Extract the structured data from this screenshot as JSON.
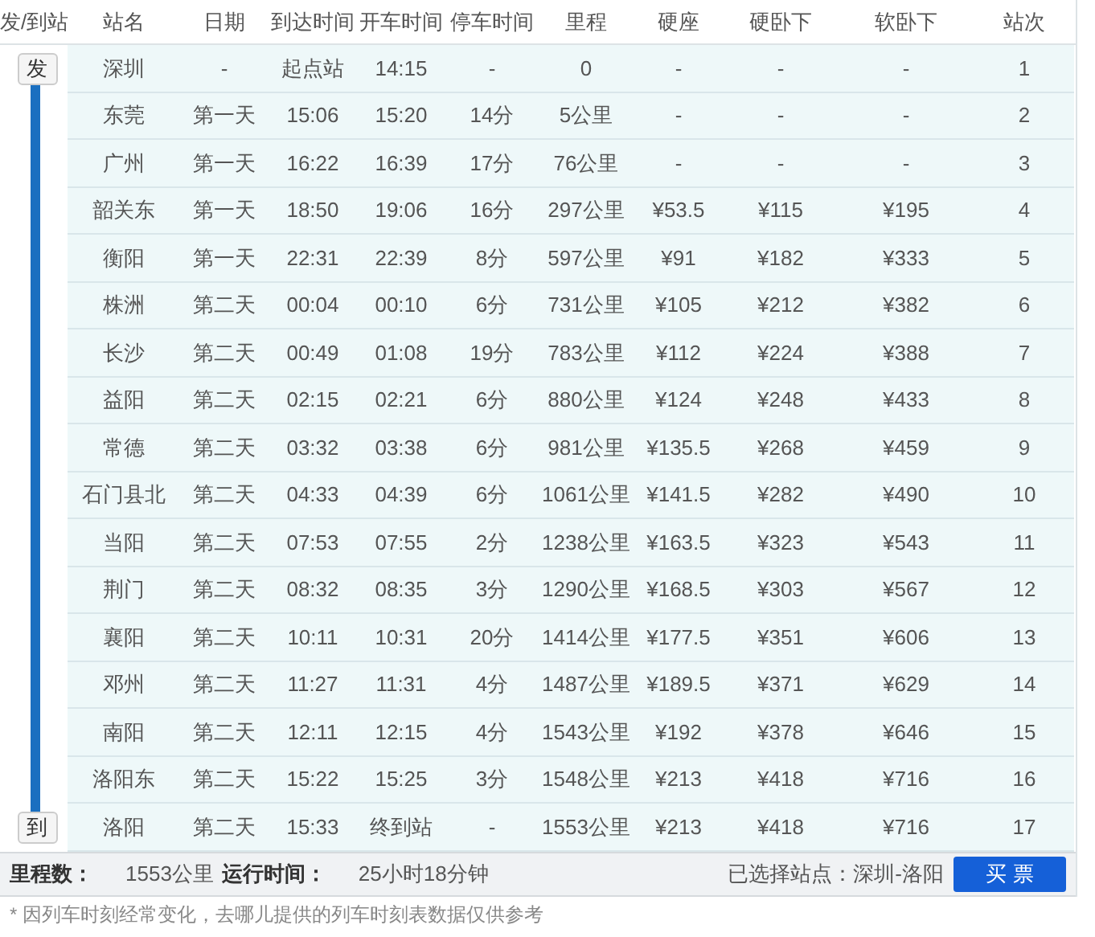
{
  "columns": [
    "发/到站",
    "站名",
    "日期",
    "到达时间",
    "开车时间",
    "停车时间",
    "里程",
    "硬座",
    "硬卧下",
    "软卧下",
    "站次"
  ],
  "rows": [
    {
      "marker": "发",
      "station": "深圳",
      "date": "-",
      "arrive": "起点站",
      "depart": "14:15",
      "stop": "-",
      "distance": "0",
      "hard_seat": "-",
      "hard_sleeper": "-",
      "soft_sleeper": "-",
      "index": "1"
    },
    {
      "station": "东莞",
      "date": "第一天",
      "arrive": "15:06",
      "depart": "15:20",
      "stop": "14分",
      "distance": "5公里",
      "hard_seat": "-",
      "hard_sleeper": "-",
      "soft_sleeper": "-",
      "index": "2"
    },
    {
      "station": "广州",
      "date": "第一天",
      "arrive": "16:22",
      "depart": "16:39",
      "stop": "17分",
      "distance": "76公里",
      "hard_seat": "-",
      "hard_sleeper": "-",
      "soft_sleeper": "-",
      "index": "3"
    },
    {
      "station": "韶关东",
      "date": "第一天",
      "arrive": "18:50",
      "depart": "19:06",
      "stop": "16分",
      "distance": "297公里",
      "hard_seat": "¥53.5",
      "hard_sleeper": "¥115",
      "soft_sleeper": "¥195",
      "index": "4"
    },
    {
      "station": "衡阳",
      "date": "第一天",
      "arrive": "22:31",
      "depart": "22:39",
      "stop": "8分",
      "distance": "597公里",
      "hard_seat": "¥91",
      "hard_sleeper": "¥182",
      "soft_sleeper": "¥333",
      "index": "5"
    },
    {
      "station": "株洲",
      "date": "第二天",
      "arrive": "00:04",
      "depart": "00:10",
      "stop": "6分",
      "distance": "731公里",
      "hard_seat": "¥105",
      "hard_sleeper": "¥212",
      "soft_sleeper": "¥382",
      "index": "6"
    },
    {
      "station": "长沙",
      "date": "第二天",
      "arrive": "00:49",
      "depart": "01:08",
      "stop": "19分",
      "distance": "783公里",
      "hard_seat": "¥112",
      "hard_sleeper": "¥224",
      "soft_sleeper": "¥388",
      "index": "7"
    },
    {
      "station": "益阳",
      "date": "第二天",
      "arrive": "02:15",
      "depart": "02:21",
      "stop": "6分",
      "distance": "880公里",
      "hard_seat": "¥124",
      "hard_sleeper": "¥248",
      "soft_sleeper": "¥433",
      "index": "8"
    },
    {
      "station": "常德",
      "date": "第二天",
      "arrive": "03:32",
      "depart": "03:38",
      "stop": "6分",
      "distance": "981公里",
      "hard_seat": "¥135.5",
      "hard_sleeper": "¥268",
      "soft_sleeper": "¥459",
      "index": "9"
    },
    {
      "station": "石门县北",
      "date": "第二天",
      "arrive": "04:33",
      "depart": "04:39",
      "stop": "6分",
      "distance": "1061公里",
      "hard_seat": "¥141.5",
      "hard_sleeper": "¥282",
      "soft_sleeper": "¥490",
      "index": "10"
    },
    {
      "station": "当阳",
      "date": "第二天",
      "arrive": "07:53",
      "depart": "07:55",
      "stop": "2分",
      "distance": "1238公里",
      "hard_seat": "¥163.5",
      "hard_sleeper": "¥323",
      "soft_sleeper": "¥543",
      "index": "11"
    },
    {
      "station": "荆门",
      "date": "第二天",
      "arrive": "08:32",
      "depart": "08:35",
      "stop": "3分",
      "distance": "1290公里",
      "hard_seat": "¥168.5",
      "hard_sleeper": "¥303",
      "soft_sleeper": "¥567",
      "index": "12"
    },
    {
      "station": "襄阳",
      "date": "第二天",
      "arrive": "10:11",
      "depart": "10:31",
      "stop": "20分",
      "distance": "1414公里",
      "hard_seat": "¥177.5",
      "hard_sleeper": "¥351",
      "soft_sleeper": "¥606",
      "index": "13"
    },
    {
      "station": "邓州",
      "date": "第二天",
      "arrive": "11:27",
      "depart": "11:31",
      "stop": "4分",
      "distance": "1487公里",
      "hard_seat": "¥189.5",
      "hard_sleeper": "¥371",
      "soft_sleeper": "¥629",
      "index": "14"
    },
    {
      "station": "南阳",
      "date": "第二天",
      "arrive": "12:11",
      "depart": "12:15",
      "stop": "4分",
      "distance": "1543公里",
      "hard_seat": "¥192",
      "hard_sleeper": "¥378",
      "soft_sleeper": "¥646",
      "index": "15"
    },
    {
      "station": "洛阳东",
      "date": "第二天",
      "arrive": "15:22",
      "depart": "15:25",
      "stop": "3分",
      "distance": "1548公里",
      "hard_seat": "¥213",
      "hard_sleeper": "¥418",
      "soft_sleeper": "¥716",
      "index": "16"
    },
    {
      "marker": "到",
      "station": "洛阳",
      "date": "第二天",
      "arrive": "15:33",
      "depart": "终到站",
      "stop": "-",
      "distance": "1553公里",
      "hard_seat": "¥213",
      "hard_sleeper": "¥418",
      "soft_sleeper": "¥716",
      "index": "17"
    }
  ],
  "footer": {
    "distance_label": "里程数：",
    "distance": "1553公里",
    "duration_label": "运行时间：",
    "duration": "25小时18分钟",
    "selection": "已选择站点：深圳-洛阳",
    "buy_button": "买 票"
  },
  "note": "* 因列车时刻经常变化，去哪儿提供的列车时刻表数据仅供参考"
}
